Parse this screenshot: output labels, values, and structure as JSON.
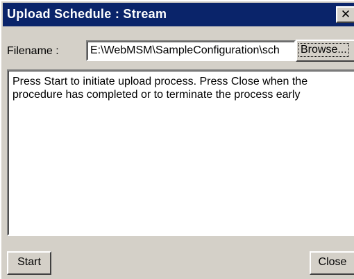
{
  "window": {
    "title": "Upload Schedule : Stream",
    "close_glyph": "✕"
  },
  "filename": {
    "label": "Filename :",
    "value": "E:\\WebMSM\\SampleConfiguration\\sch",
    "browse_label": "Browse..."
  },
  "message": {
    "text": "Press Start to initiate upload process. Press Close when the procedure has completed or to terminate the process early"
  },
  "buttons": {
    "start_label": "Start",
    "close_label": "Close"
  },
  "colors": {
    "titlebar": "#0a246a",
    "face": "#d4d0c8"
  }
}
